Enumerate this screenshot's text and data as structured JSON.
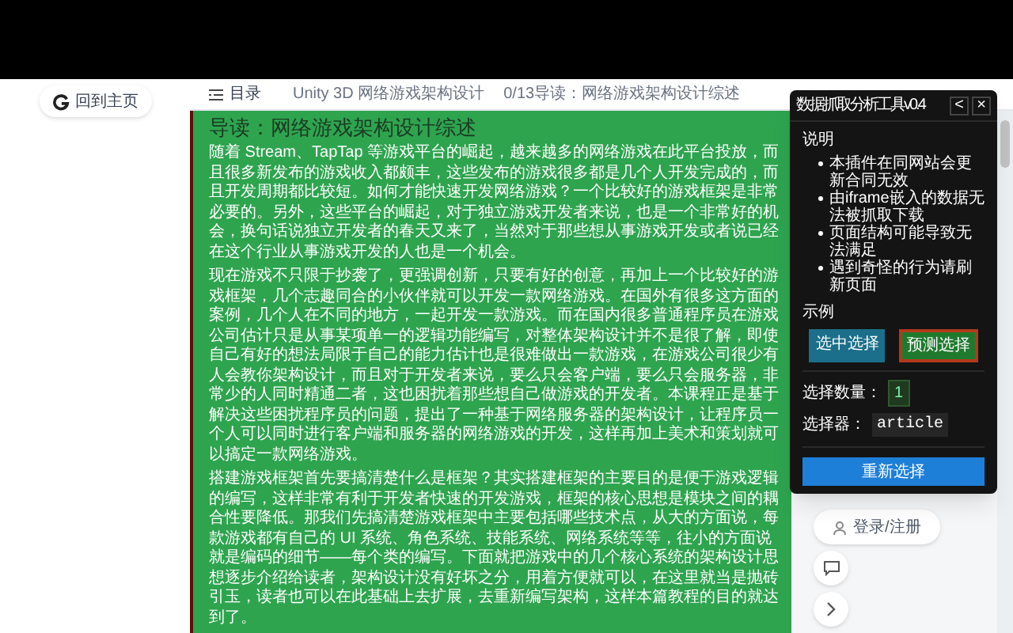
{
  "sidebar": {
    "home_link": "回到主页"
  },
  "header": {
    "toc": "目录",
    "breadcrumb": [
      "Unity 3D 网络游戏架构设计",
      "0/13导读：网络游戏架构设计综述"
    ]
  },
  "article": {
    "title": "导读：网络游戏架构设计综述",
    "paragraphs": [
      "随着 Stream、TapTap 等游戏平台的崛起，越来越多的网络游戏在此平台投放，而且很多新发布的游戏收入都颇丰，这些发布的游戏很多都是几个人开发完成的，而且开发周期都比较短。如何才能快速开发网络游戏？一个比较好的游戏框架是非常必要的。另外，这些平台的崛起，对于独立游戏开发者来说，也是一个非常好的机会，换句话说独立开发者的春天又来了，当然对于那些想从事游戏开发或者说已经在这个行业从事游戏开发的人也是一个机会。",
      "现在游戏不只限于抄袭了，更强调创新，只要有好的创意，再加上一个比较好的游戏框架，几个志趣同合的小伙伴就可以开发一款网络游戏。在国外有很多这方面的案例，几个人在不同的地方，一起开发一款游戏。而在国内很多普通程序员在游戏公司估计只是从事某项单一的逻辑功能编写，对整体架构设计并不是很了解，即使自己有好的想法局限于自己的能力估计也是很难做出一款游戏，在游戏公司很少有人会教你架构设计，而且对于开发者来说，要么只会客户端，要么只会服务器，非常少的人同时精通二者，这也困扰着那些想自己做游戏的开发者。本课程正是基于解决这些困扰程序员的问题，提出了一种基于网络服务器的架构设计，让程序员一个人可以同时进行客户端和服务器的网络游戏的开发，这样再加上美术和策划就可以搞定一款网络游戏。",
      "搭建游戏框架首先要搞清楚什么是框架？其实搭建框架的主要目的是便于游戏逻辑的编写，这样非常有利于开发者快速的开发游戏，框架的核心思想是模块之间的耦合性要降低。那我们先搞清楚游戏框架中主要包括哪些技术点，从大的方面说，每款游戏都有自己的 UI 系统、角色系统、技能系统、网络系统等等，往小的方面说就是编码的细节——每个类的编写。下面就把游戏中的几个核心系统的架构设计思想逐步介绍给读者，架构设计没有好坏之分，用着方便就可以，在这里就当是抛砖引玉，读者也可以在此基础上去扩展，去重新编写架构，这样本篇教程的目的就达到了。"
    ]
  },
  "side_actions": {
    "login": "登录/注册"
  },
  "tool_panel": {
    "title": "数据抓取分析工具v0.4",
    "back": "<",
    "close": "×",
    "notes_heading": "说明",
    "notes": [
      "本插件在同网站会更新合同无效",
      "由iframe嵌入的数据无法被抓取下载",
      "页面结构可能导致无法满足",
      "遇到奇怪的行为请刷新页面"
    ],
    "examples_heading": "示例",
    "examples": [
      {
        "kind": "selected",
        "label": "选中选择"
      },
      {
        "kind": "predicted",
        "label": "预测选择"
      }
    ],
    "count_label": "选择数量：",
    "count": "1",
    "selector_label": "选择器：",
    "selector": "article",
    "reselect": "重新选择"
  }
}
